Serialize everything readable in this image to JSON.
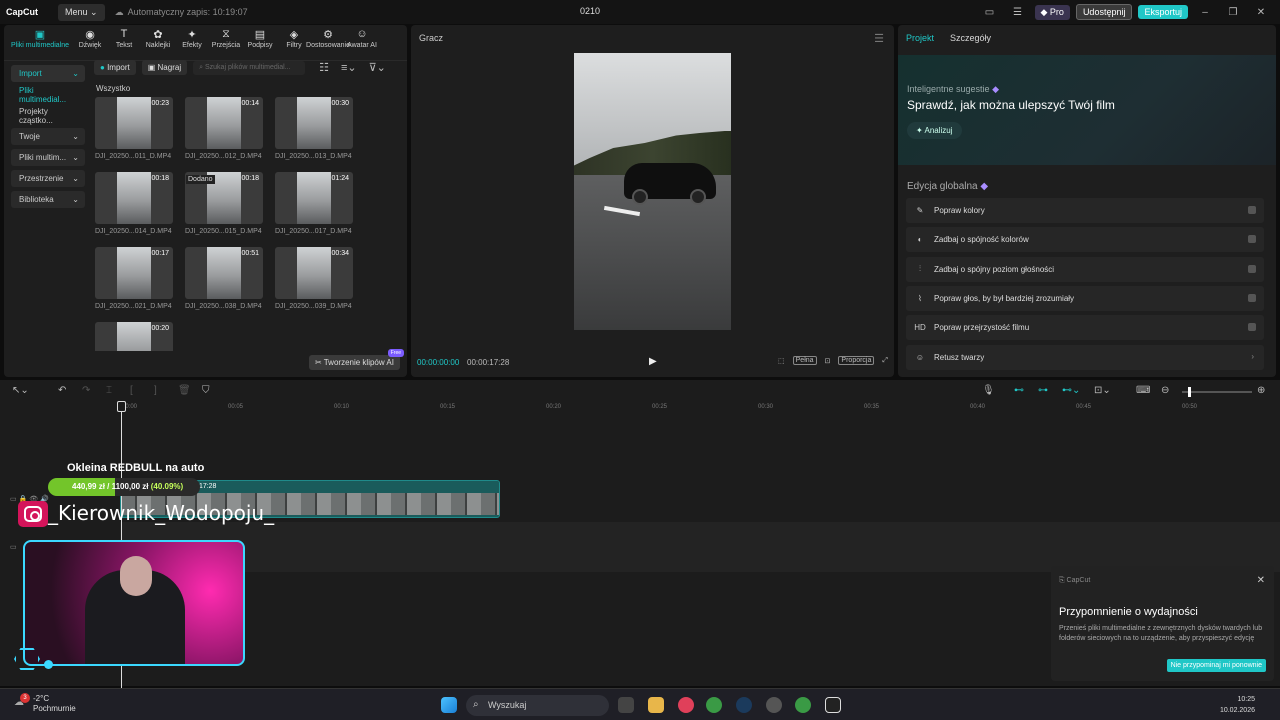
{
  "titlebar": {
    "logo": "CapCut",
    "menu": "Menu",
    "autosave": "Automatyczny zapis: 10:19:07",
    "title": "0210",
    "pro": "Pro",
    "share": "Udostępnij",
    "export": "Eksportuj"
  },
  "tools": [
    {
      "label": "Pliki multimedialne",
      "icon": "media-icon"
    },
    {
      "label": "Dźwięk",
      "icon": "audio-icon"
    },
    {
      "label": "Tekst",
      "icon": "text-icon"
    },
    {
      "label": "Naklejki",
      "icon": "sticker-icon"
    },
    {
      "label": "Efekty",
      "icon": "effects-icon"
    },
    {
      "label": "Przejścia",
      "icon": "transition-icon"
    },
    {
      "label": "Podpisy",
      "icon": "captions-icon"
    },
    {
      "label": "Filtry",
      "icon": "filter-icon"
    },
    {
      "label": "Dostosowanie",
      "icon": "adjust-icon"
    },
    {
      "label": "Awatar AI",
      "icon": "avatar-icon"
    }
  ],
  "sidebar": [
    "Import",
    "Pliki multimedial...",
    "Projekty cząstko...",
    "Twoje",
    "Pliki multim...",
    "Przestrzenie",
    "Biblioteka"
  ],
  "media": {
    "import": "Import",
    "record": "Nagraj",
    "search_placeholder": "Szukaj plików multimedial...",
    "all": "Wszystko",
    "added": "Dodano",
    "ai_clips": "Tworzenie klipów AI",
    "free": "Free",
    "items": [
      {
        "dur": "00:23",
        "name": "DJI_20250...011_D.MP4"
      },
      {
        "dur": "00:14",
        "name": "DJI_20250...012_D.MP4"
      },
      {
        "dur": "00:30",
        "name": "DJI_20250...013_D.MP4"
      },
      {
        "dur": "00:18",
        "name": "DJI_20250...014_D.MP4"
      },
      {
        "dur": "00:18",
        "name": "DJI_20250...015_D.MP4"
      },
      {
        "dur": "01:24",
        "name": "DJI_20250...017_D.MP4"
      },
      {
        "dur": "00:17",
        "name": "DJI_20250...021_D.MP4"
      },
      {
        "dur": "00:51",
        "name": "DJI_20250...038_D.MP4"
      },
      {
        "dur": "00:34",
        "name": "DJI_20250...039_D.MP4"
      },
      {
        "dur": "00:20",
        "name": ""
      }
    ]
  },
  "player": {
    "title": "Gracz",
    "current": "00:00:00:00",
    "total": "00:00:17:28",
    "full": "Pełna",
    "ratio": "Proporcja"
  },
  "props": {
    "tab1": "Projekt",
    "tab2": "Szczegóły",
    "suggest": "Inteligentne sugestie",
    "suggest_title": "Sprawdź, jak można ulepszyć Twój film",
    "analyze": "Analizuj",
    "global": "Edycja globalna",
    "rows": [
      "Popraw kolory",
      "Zadbaj o spójność kolorów",
      "Zadbaj o spójny poziom głośności",
      "Popraw głos, by był bardziej zrozumiały",
      "Popraw przejrzystość filmu",
      "Retusz twarzy"
    ]
  },
  "ruler": [
    "00:00",
    "00:05",
    "00:10",
    "00:15",
    "00:20",
    "00:25",
    "00:30",
    "00:35",
    "00:40",
    "00:45",
    "00:50"
  ],
  "clip": {
    "label": "...7.0010_D.MP4  00:00:17:28"
  },
  "overlay": {
    "title": "Okleina REDBULL na auto",
    "goal": "440,99 zł / 1100,00 zł",
    "pct": "(40.09%)",
    "progress": 40.09,
    "handle": "_Kierownik_Wodopoju_"
  },
  "notif": {
    "app": "CapCut",
    "heading": "Przypomnienie o wydajności",
    "body": "Przenieś pliki multimedialne z zewnętrznych dysków twardych lub folderów sieciowych na to urządzenie, aby przyspieszyć edycję",
    "button": "Nie przypominaj mi ponownie"
  },
  "taskbar": {
    "temp": "-2°C",
    "cond": "Pochmurnie",
    "badge": "3",
    "search": "Wyszukaj",
    "time": "10:25",
    "date": "10.02.2026"
  }
}
